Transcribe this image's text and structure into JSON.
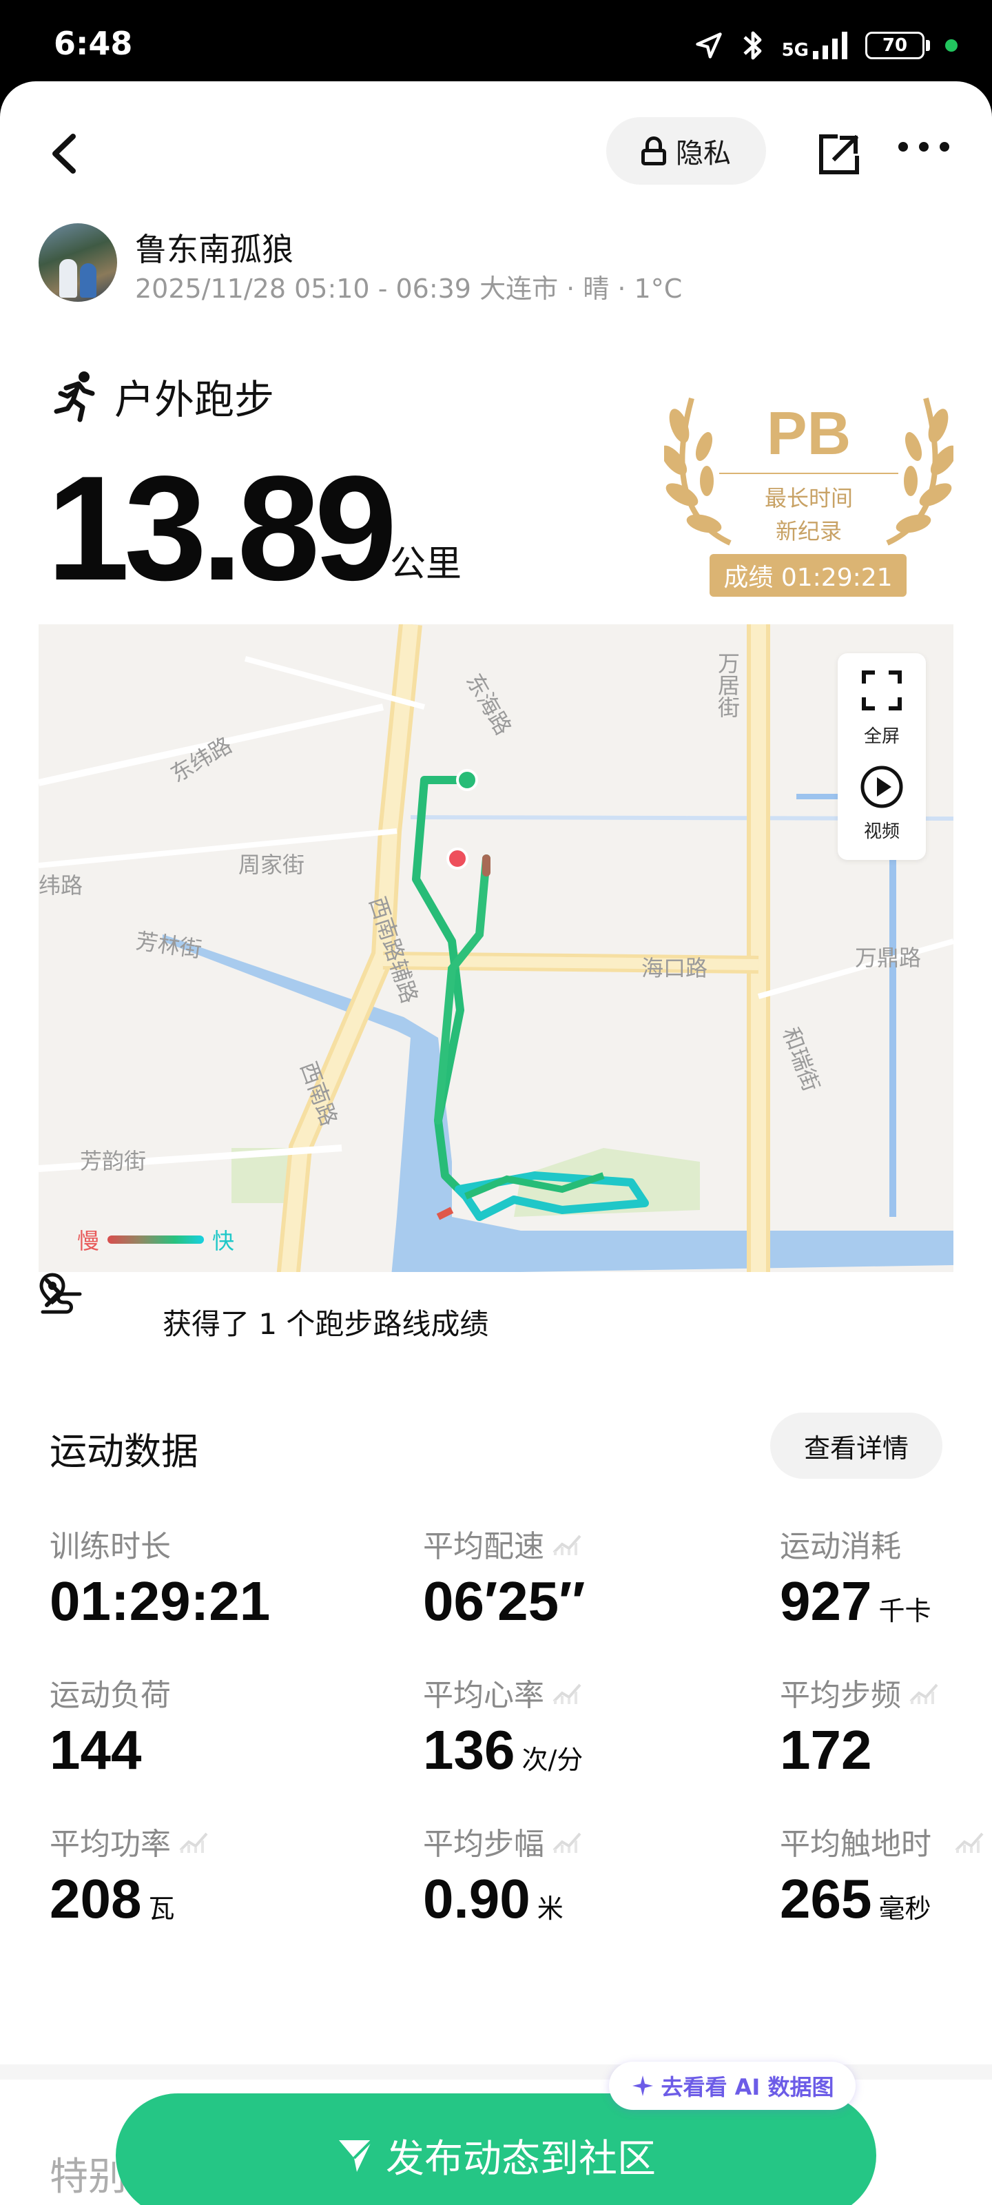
{
  "status_bar": {
    "time": "6:48",
    "signal": "5G",
    "battery": "70"
  },
  "header": {
    "privacy_label": "隐私"
  },
  "user": {
    "name": "鲁东南孤狼",
    "meta": "2025/11/28 05:10 - 06:39 大连市 · 晴 · 1°C"
  },
  "activity": {
    "type": "户外跑步",
    "distance": "13.89",
    "distance_unit": "公里"
  },
  "pb_badge": {
    "title": "PB",
    "line1": "最长时间",
    "line2": "新纪录",
    "score": "成绩 01:29:21",
    "color": "#dbb473"
  },
  "map": {
    "fullscreen_label": "全屏",
    "video_label": "视频",
    "legend_slow": "慢",
    "legend_fast": "快",
    "streets": [
      "东纬路",
      "东海路",
      "万居街",
      "周家街",
      "纬路",
      "芳林街",
      "西南路辅路",
      "海口路",
      "万鼎路",
      "和瑞街",
      "西南路",
      "芳韵街"
    ],
    "route_banner": "获得了 1 个跑步路线成绩"
  },
  "stats_section": {
    "title": "运动数据",
    "details_button": "查看详情",
    "items": [
      {
        "label": "训练时长",
        "value": "01:29:21",
        "unit": ""
      },
      {
        "label": "平均配速",
        "value": "06′25″",
        "unit": ""
      },
      {
        "label": "运动消耗",
        "value": "927",
        "unit": "千卡"
      },
      {
        "label": "运动负荷",
        "value": "144",
        "unit": ""
      },
      {
        "label": "平均心率",
        "value": "136",
        "unit": "次/分"
      },
      {
        "label": "平均步频",
        "value": "172",
        "unit": ""
      },
      {
        "label": "平均功率",
        "value": "208",
        "unit": "瓦"
      },
      {
        "label": "平均步幅",
        "value": "0.90",
        "unit": "米"
      },
      {
        "label": "平均触地时",
        "value": "265",
        "unit": "毫秒"
      }
    ]
  },
  "footer": {
    "special_title": "特别",
    "ai_label": "去看看 AI 数据图",
    "publish_button": "发布动态到社区",
    "accent": "#25c685"
  }
}
